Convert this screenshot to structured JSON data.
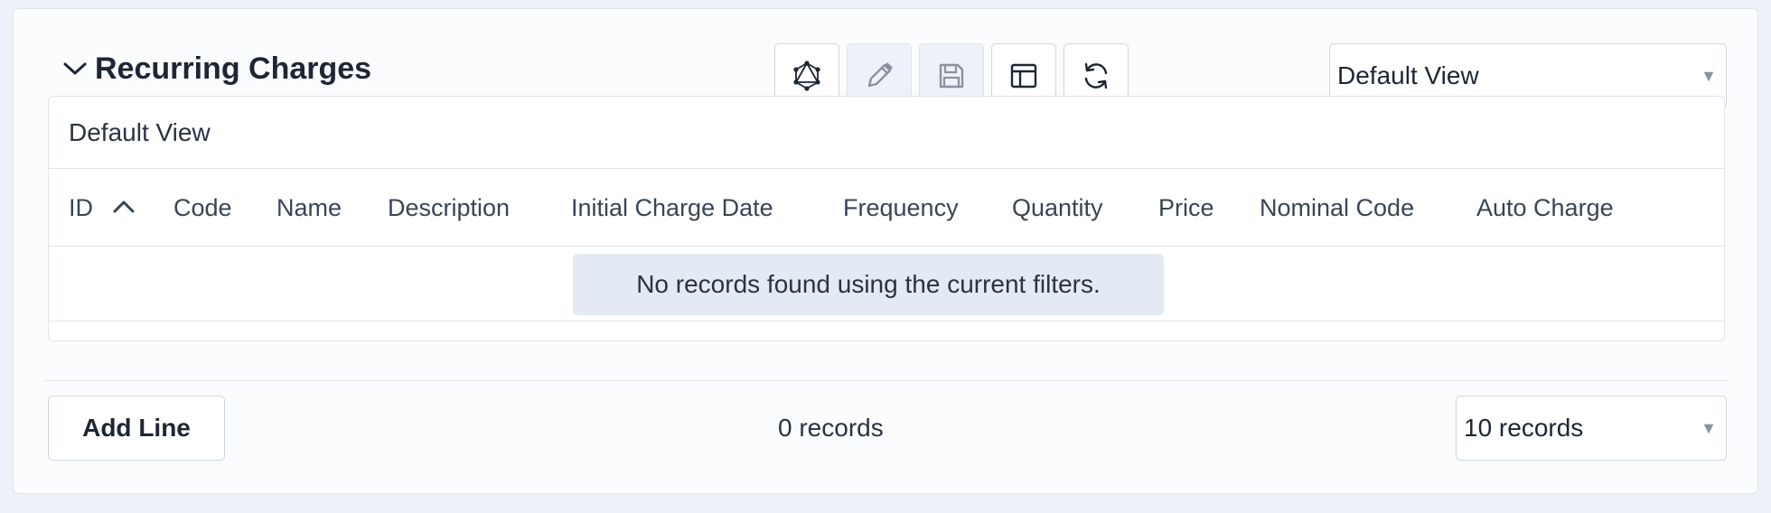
{
  "section": {
    "title": "Recurring Charges"
  },
  "toolbar": {
    "buttons": [
      {
        "icon": "graphql-icon"
      },
      {
        "icon": "pencil-icon",
        "disabled": true
      },
      {
        "icon": "save-icon",
        "disabled": true
      },
      {
        "icon": "layout-icon"
      },
      {
        "icon": "refresh-icon"
      }
    ],
    "view_select": "Default View"
  },
  "grid": {
    "view_title": "Default View",
    "columns": [
      "ID",
      "Code",
      "Name",
      "Description",
      "Initial Charge Date",
      "Frequency",
      "Quantity",
      "Price",
      "Nominal Code",
      "Auto Charge"
    ],
    "sort": {
      "column": "ID",
      "direction": "ascending"
    },
    "empty_message": "No records found using the current filters."
  },
  "footer": {
    "add_line_label": "Add Line",
    "records_count": "0 records",
    "page_size": "10 records"
  }
}
